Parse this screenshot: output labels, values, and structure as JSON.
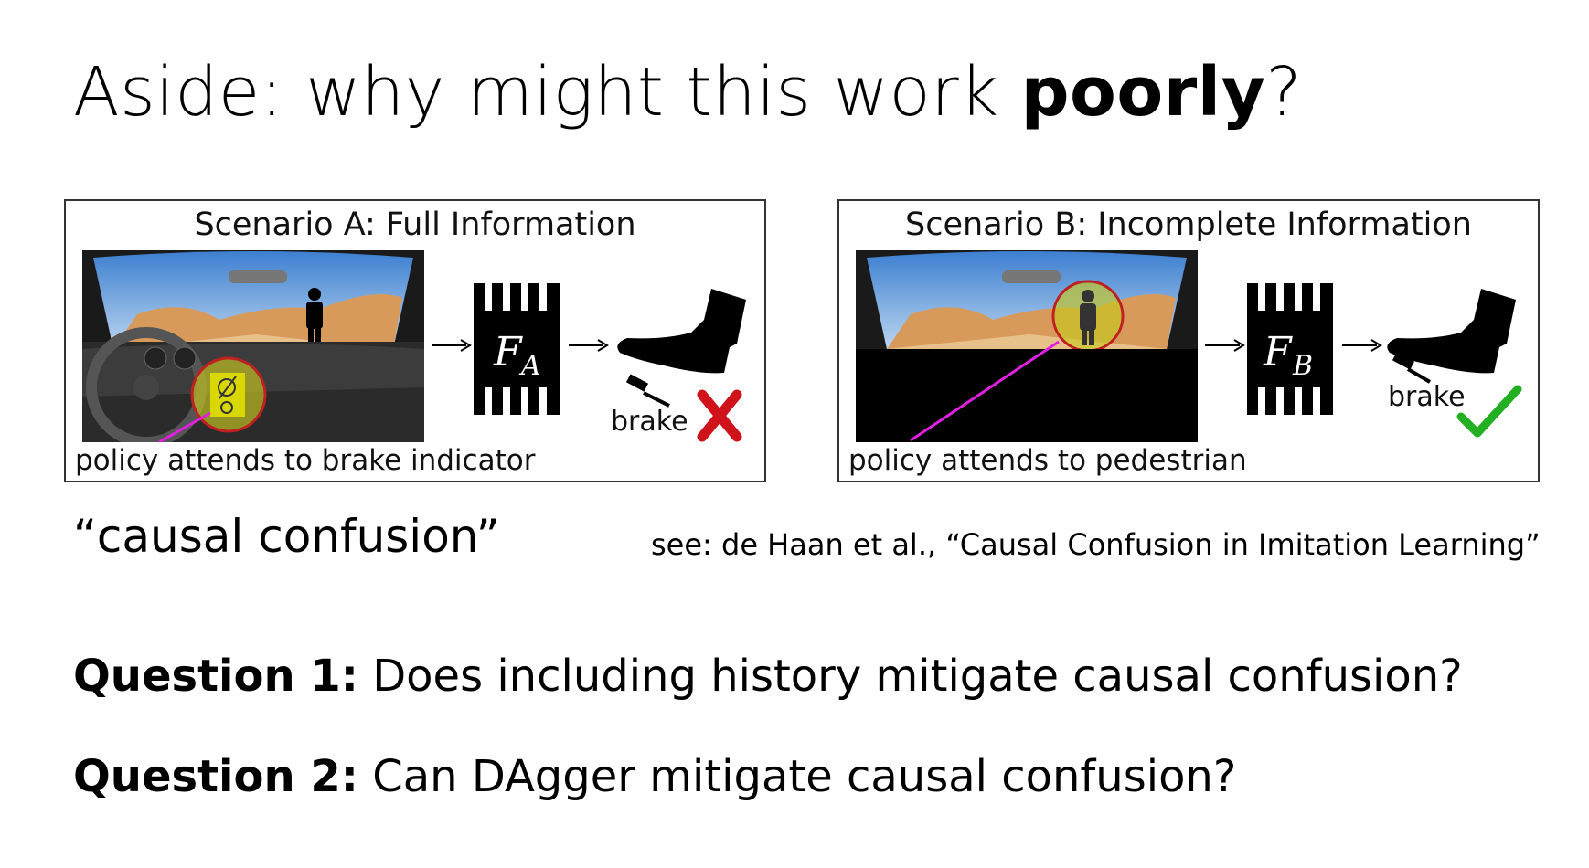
{
  "slide": {
    "title_prefix": "Aside: why might this work ",
    "title_emphasis": "poorly",
    "title_suffix": "?",
    "causal_label": "“causal confusion”",
    "citation": "see: de Haan et al., “Causal Confusion in Imitation Learning”",
    "questions": [
      {
        "label": "Question 1:",
        "text": " Does including history mitigate causal confusion?"
      },
      {
        "label": "Question 2:",
        "text": " Can DAgger mitigate causal confusion?"
      }
    ]
  },
  "figure": {
    "scenario_a": {
      "title": "Scenario A: Full Information",
      "caption": "policy attends to brake indicator",
      "brake_label": "brake",
      "function_symbol": "F",
      "function_subscript": "A",
      "outcome": "wrong",
      "outcome_color": "#d0121b"
    },
    "scenario_b": {
      "title": "Scenario B: Incomplete Information",
      "caption": "policy attends to pedestrian",
      "brake_label": "brake",
      "function_symbol": "F",
      "function_subscript": "B",
      "outcome": "correct",
      "outcome_color": "#22b022"
    },
    "attention_color": "#cc2222",
    "arrow_color": "#e020e0"
  }
}
